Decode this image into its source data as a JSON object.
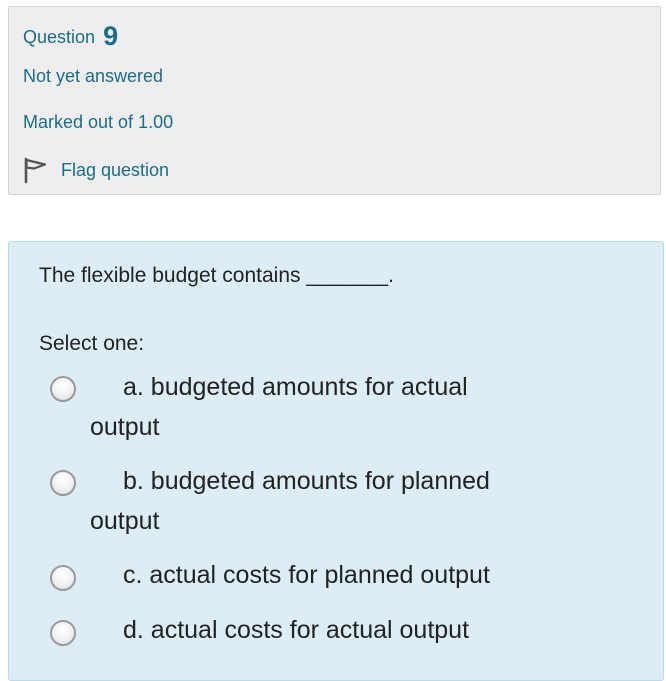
{
  "info": {
    "question_label": "Question",
    "question_number": "9",
    "state": "Not yet answered",
    "grade": "Marked out of 1.00",
    "flag_label": "Flag question"
  },
  "question": {
    "text": "The flexible budget contains _______.",
    "prompt": "Select one:",
    "answers": [
      {
        "line1": "a. budgeted amounts for actual",
        "line2": "output",
        "selected": false
      },
      {
        "line1": "b. budgeted amounts for planned",
        "line2": "output",
        "selected": false
      },
      {
        "line1": "c. actual costs for planned output",
        "line2": "",
        "selected": false
      },
      {
        "line1": "d. actual costs for actual output",
        "line2": "",
        "selected": false
      }
    ]
  },
  "colors": {
    "info_background": "#eeeeee",
    "content_background": "#dcedf5",
    "link_text": "#1a6d8c",
    "body_text": "#222222"
  },
  "icons": {
    "flag": "flag-icon",
    "radio": "radio-button"
  }
}
